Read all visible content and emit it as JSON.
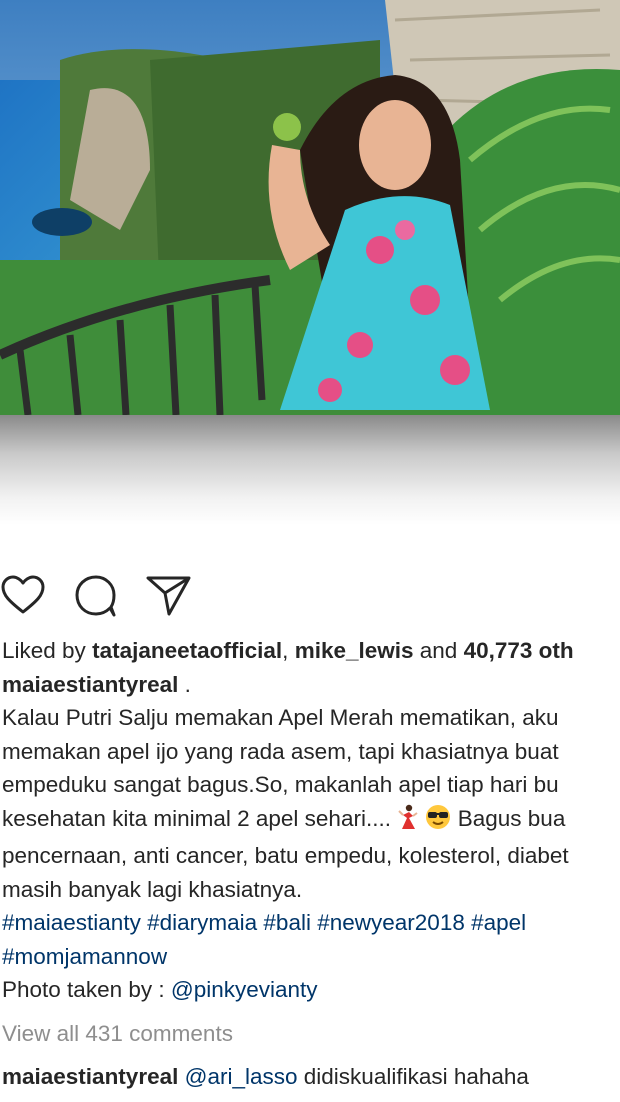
{
  "post": {
    "photo_alt": "photo",
    "likes": {
      "prefix": "Liked by",
      "user1": "tatajaneetaofficial",
      "comma": ",",
      "user2": "mike_lewis",
      "and": "and",
      "count": "40,773 oth"
    },
    "author": "maiaestiantyreal",
    "author_suffix": ".",
    "caption_lines": [
      "Kalau Putri Salju memakan Apel Merah mematikan, aku",
      "memakan apel ijo yang rada asem, tapi khasiatnya buat",
      "empeduku sangat bagus.So, makanlah apel tiap hari bu",
      "kesehatan kita minimal 2 apel sehari....",
      "Bagus bua",
      "pencernaan, anti cancer, batu empedu, kolesterol, diabet",
      "masih banyak lagi khasiatnya."
    ],
    "hashtags": [
      "#maiaestianty",
      "#diarymaia",
      "#bali",
      "#newyear2018",
      "#apel",
      "#momjamannow"
    ],
    "photo_credit_prefix": "Photo taken by :",
    "photo_credit_user": "@pinkyevianty",
    "view_comments": "View all 431 comments",
    "comment": {
      "author": "maiaestiantyreal",
      "mention": "@ari_lasso",
      "text": "didiskualifikasi hahaha"
    }
  },
  "icons": [
    "heart-icon",
    "comment-icon",
    "share-icon",
    "dancer-emoji-icon",
    "sunglasses-emoji-icon"
  ],
  "colors": {
    "text": "#262626",
    "link": "#003569",
    "muted": "#8e8e8e"
  }
}
